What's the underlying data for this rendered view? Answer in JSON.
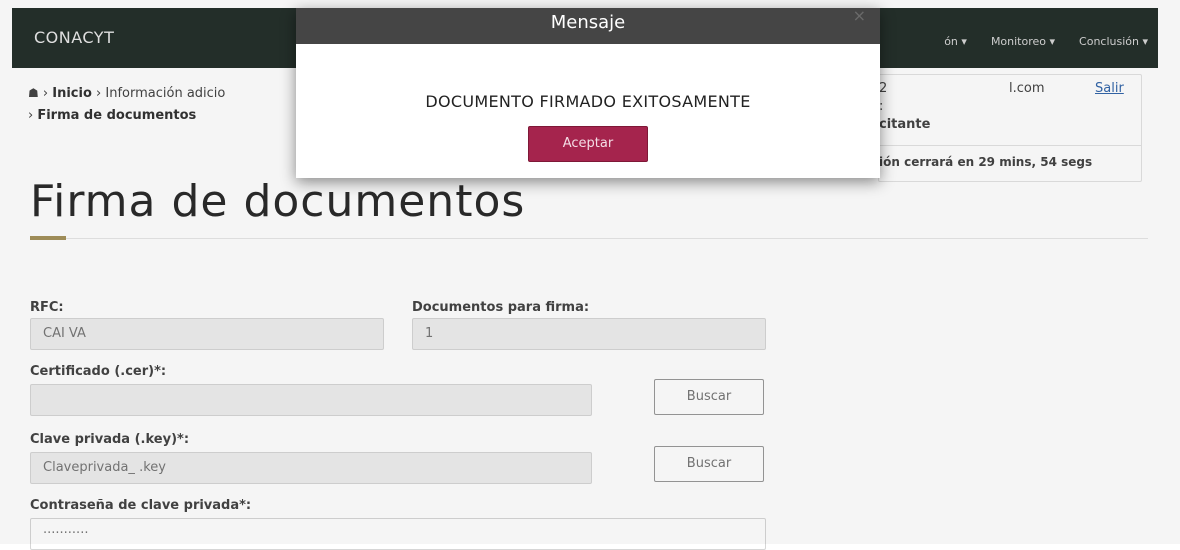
{
  "header": {
    "brand": "CONACYT",
    "nav": [
      "ón ▾",
      "Monitoreo ▾",
      "Conclusión ▾"
    ]
  },
  "breadcrumb": {
    "home_icon": "home-icon",
    "inicio": "Inicio",
    "info": "Información adicio",
    "current": "Firma de documentos"
  },
  "user_panel": {
    "line1_start": "2",
    "line1_email": "l.com",
    "logout": "Salir",
    "line2": ":",
    "role": "citante",
    "session": "ión cerrará en 29 mins, 54 segs"
  },
  "page": {
    "title": "Firma de documentos",
    "accent_color": "#a5925c"
  },
  "form": {
    "rfc_label": "RFC:",
    "rfc_value": "CAI              VA",
    "docs_label": "Documentos para firma:",
    "docs_value": "1",
    "cert_label": "Certificado (.cer)*:",
    "cert_value": "",
    "key_label": "Clave privada (.key)*:",
    "key_value": "Claveprivada_                                      .key",
    "password_label": "Contraseña de clave privada*:",
    "password_value": "···········",
    "search_button": "Buscar"
  },
  "modal": {
    "title": "Mensaje",
    "close": "×",
    "message": "DOCUMENTO FIRMADO EXITOSAMENTE",
    "accept_button": "Aceptar",
    "accept_color": "#a5244d"
  }
}
